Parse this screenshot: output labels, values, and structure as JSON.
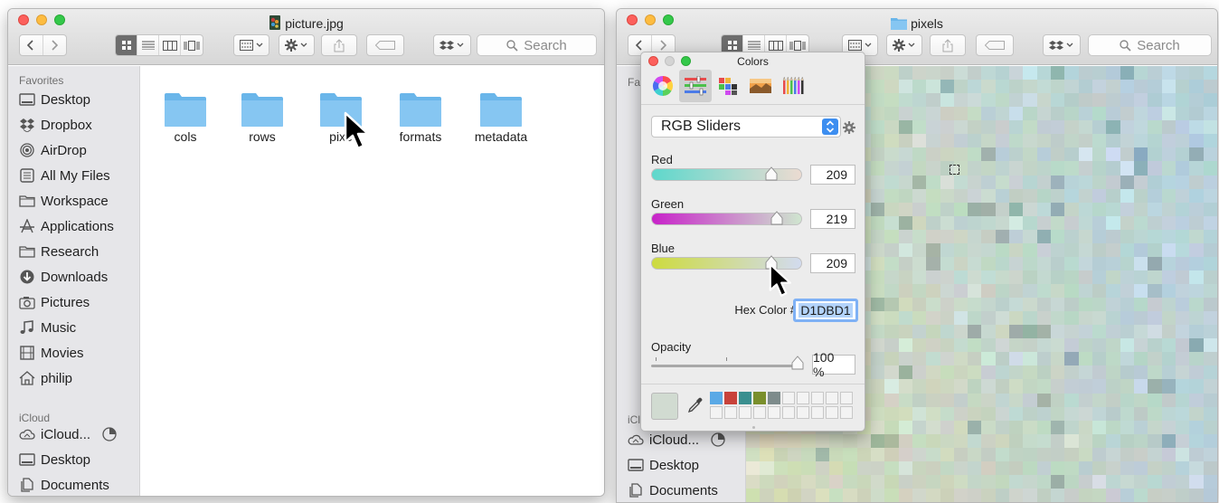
{
  "window_left": {
    "title": "picture.jpg",
    "toolbar": {
      "search_placeholder": "Search"
    },
    "sidebar": {
      "favorites_heading": "Favorites",
      "favorites": [
        {
          "label": "Desktop",
          "icon": "desktop-icon"
        },
        {
          "label": "Dropbox",
          "icon": "dropbox-icon"
        },
        {
          "label": "AirDrop",
          "icon": "airdrop-icon"
        },
        {
          "label": "All My Files",
          "icon": "all-files-icon"
        },
        {
          "label": "Workspace",
          "icon": "folder-icon"
        },
        {
          "label": "Applications",
          "icon": "applications-icon"
        },
        {
          "label": "Research",
          "icon": "folder-icon"
        },
        {
          "label": "Downloads",
          "icon": "downloads-icon"
        },
        {
          "label": "Pictures",
          "icon": "camera-icon"
        },
        {
          "label": "Music",
          "icon": "music-icon"
        },
        {
          "label": "Movies",
          "icon": "film-icon"
        },
        {
          "label": "philip",
          "icon": "home-icon"
        }
      ],
      "icloud_heading": "iCloud",
      "icloud": [
        {
          "label": "iCloud...",
          "icon": "cloud-icon"
        },
        {
          "label": "Desktop",
          "icon": "desktop-icon"
        },
        {
          "label": "Documents",
          "icon": "documents-icon"
        }
      ]
    },
    "folders": [
      "cols",
      "rows",
      "pixels",
      "formats",
      "metadata"
    ],
    "folder_labels_visible": [
      "cols",
      "rows",
      "pixe",
      "formats",
      "metadata"
    ]
  },
  "window_right": {
    "title": "pixels",
    "toolbar": {
      "search_placeholder": "Search"
    },
    "sidebar": {
      "favorites_heading": "Fav",
      "icloud_heading": "iCl",
      "icloud": [
        {
          "label": "iCloud...",
          "icon": "cloud-icon"
        },
        {
          "label": "Desktop",
          "icon": "desktop-icon"
        },
        {
          "label": "Documents",
          "icon": "documents-icon"
        }
      ]
    }
  },
  "colors_panel": {
    "title": "Colors",
    "modes": [
      "color-wheel",
      "color-sliders",
      "color-palettes",
      "image-palettes",
      "pencils"
    ],
    "active_mode": "color-sliders",
    "slider_mode": "RGB Sliders",
    "sliders": [
      {
        "label": "Red",
        "value": "209"
      },
      {
        "label": "Green",
        "value": "219"
      },
      {
        "label": "Blue",
        "value": "209"
      }
    ],
    "hex_label": "Hex Color #",
    "hex_value": "D1DBD1",
    "opacity_label": "Opacity",
    "opacity_value": "100 %",
    "current_color": "#D1DBD1",
    "palette_swatches": [
      "#5aa9e6",
      "#c8423a",
      "#3a8f8f",
      "#7a8f2c",
      "#7d8b8b"
    ]
  }
}
